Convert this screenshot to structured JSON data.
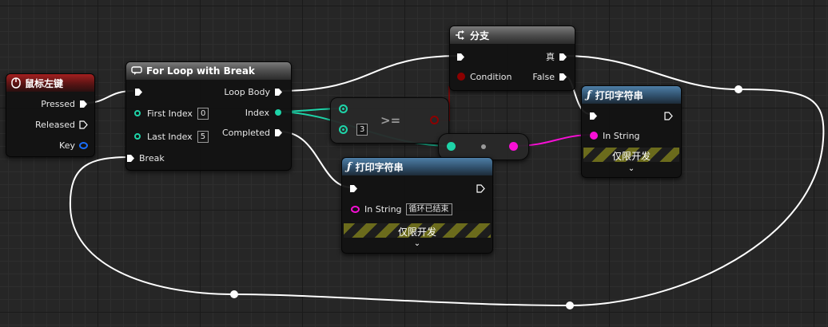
{
  "event_node": {
    "title": "鼠标左键",
    "pins": {
      "pressed": "Pressed",
      "released": "Released",
      "key": "Key"
    }
  },
  "for_loop": {
    "title": "For Loop with Break",
    "pins": {
      "first_index": "First Index",
      "first_index_value": "0",
      "last_index": "Last Index",
      "last_index_value": "5",
      "break": "Break",
      "loop_body": "Loop Body",
      "index": "Index",
      "completed": "Completed"
    }
  },
  "branch": {
    "title": "分支",
    "pins": {
      "condition": "Condition",
      "true_label": "真",
      "false_label": "False"
    }
  },
  "compare": {
    "operator": ">=",
    "b_value": "3"
  },
  "print_right": {
    "title": "打印字符串",
    "in_string": "In String",
    "dev_only": "仅限开发"
  },
  "print_bottom": {
    "title": "打印字符串",
    "in_string": "In String",
    "in_string_value": "循环已结束",
    "dev_only": "仅限开发"
  },
  "colors": {
    "exec": "#ffffff",
    "int": "#1ed3a8",
    "string": "#f80fd6",
    "bool": "#8c0000",
    "struct": "#1a6fff",
    "func_header": "#30506c",
    "event_header": "#8a1e1e"
  },
  "icons": {
    "event": "mouse-icon",
    "macro": "loop-macro-icon",
    "branch": "branch-icon",
    "function": "function-icon"
  }
}
